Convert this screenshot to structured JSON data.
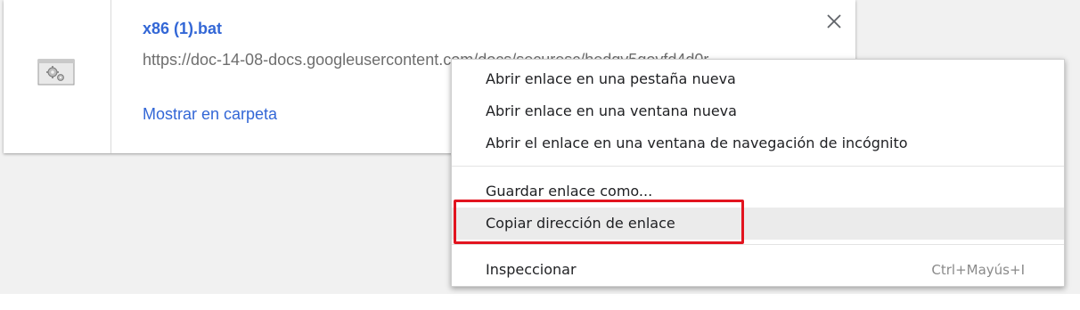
{
  "download": {
    "file_name": "x86 (1).bat",
    "url": "https://doc-14-08-docs.googleusercontent.com/docs/securesc/hedgv5govfd4d0r",
    "show_in_folder": "Mostrar en carpeta"
  },
  "context_menu": {
    "items": [
      {
        "label": "Abrir enlace en una pestaña nueva"
      },
      {
        "label": "Abrir enlace en una ventana nueva"
      },
      {
        "label": "Abrir el enlace en una ventana de navegación de incógnito"
      },
      {
        "label": "Guardar enlace como..."
      },
      {
        "label": "Copiar dirección de enlace"
      },
      {
        "label": "Inspeccionar",
        "shortcut": "Ctrl+Mayús+I"
      }
    ],
    "hovered_index": 4
  },
  "colors": {
    "link": "#3367d6",
    "highlight_border": "#e2141f",
    "hover_bg": "#ebebeb"
  },
  "icons": {
    "file": "gear-file-icon",
    "close": "close-icon"
  }
}
